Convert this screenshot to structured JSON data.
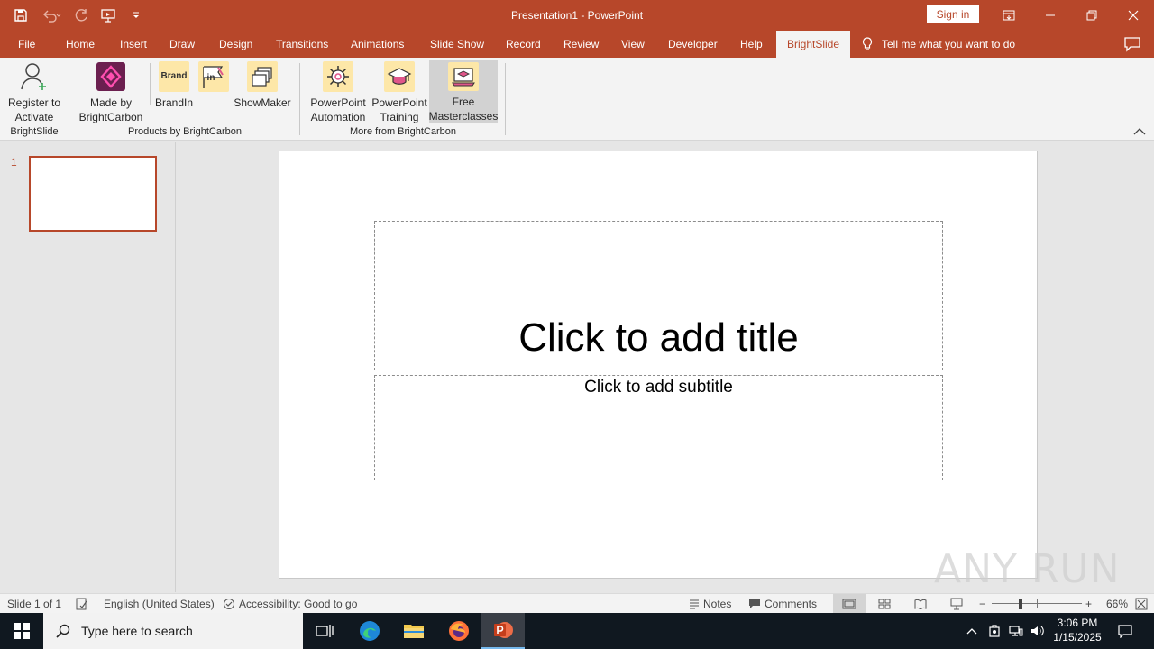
{
  "window": {
    "title": "Presentation1  -  PowerPoint",
    "sign_in": "Sign in"
  },
  "qat": {
    "icons": [
      "save-icon",
      "undo-icon",
      "redo-icon",
      "present-from-beginning-icon",
      "customize-qat-icon"
    ]
  },
  "tabs": [
    "File",
    "Home",
    "Insert",
    "Draw",
    "Design",
    "Transitions",
    "Animations",
    "Slide Show",
    "Record",
    "Review",
    "View",
    "Developer",
    "Help",
    "BrightSlide"
  ],
  "active_tab": "BrightSlide",
  "tell_me": "Tell me what you want to do",
  "ribbon": {
    "register_line1": "Register to",
    "register_line2": "Activate",
    "madeby_line1": "Made by",
    "madeby_line2": "BrightCarbon",
    "brandin": "BrandIn",
    "showmaker": "ShowMaker",
    "automation_line1": "PowerPoint",
    "automation_line2": "Automation",
    "training_line1": "PowerPoint",
    "training_line2": "Training",
    "masterclass_line1": "Free",
    "masterclass_line2": "Masterclasses",
    "groups": {
      "brightslide": "BrightSlide",
      "products": "Products by BrightCarbon",
      "more": "More from BrightCarbon"
    },
    "brandin_icon_text": "Brand",
    "linkedin_icon_text": "in"
  },
  "thumbs": {
    "number": "1"
  },
  "slide": {
    "title_placeholder": "Click to add title",
    "subtitle_placeholder": "Click to add subtitle"
  },
  "watermark": "ANY RUN",
  "statusbar": {
    "slide_count": "Slide 1 of 1",
    "language": "English (United States)",
    "accessibility": "Accessibility: Good to go",
    "notes": "Notes",
    "comments": "Comments",
    "zoom": "66%",
    "zoom_out": "−",
    "zoom_in": "+"
  },
  "taskbar": {
    "search_placeholder": "Type here to search",
    "time": "3:06 PM",
    "date": "1/15/2025"
  },
  "colors": {
    "accent": "#b7472a",
    "taskbar": "#101820"
  }
}
